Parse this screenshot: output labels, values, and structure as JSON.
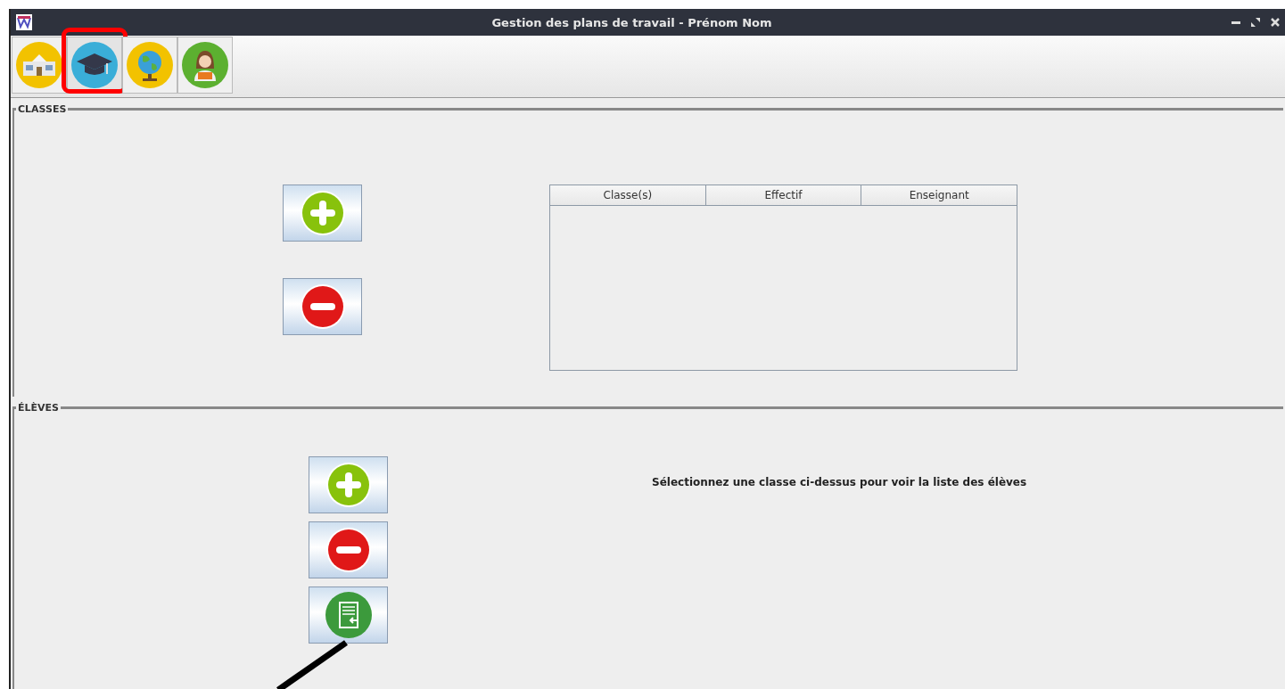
{
  "window": {
    "title": "Gestion des plans de travail - Prénom Nom"
  },
  "toolbar": [
    {
      "kind": "school",
      "selected": false
    },
    {
      "kind": "graduation",
      "selected": true
    },
    {
      "kind": "globe",
      "selected": false
    },
    {
      "kind": "teacher",
      "selected": false
    }
  ],
  "classes": {
    "title": "CLASSES",
    "buttons": [
      {
        "kind": "add"
      },
      {
        "kind": "remove"
      }
    ],
    "table": {
      "columns": [
        "Classe(s)",
        "Effectif",
        "Enseignant"
      ]
    }
  },
  "students": {
    "title": "ÉLÈVES",
    "buttons": [
      {
        "kind": "add"
      },
      {
        "kind": "remove"
      },
      {
        "kind": "import"
      }
    ],
    "message": "Sélectionnez une classe ci-dessus pour voir la liste des élèves"
  }
}
